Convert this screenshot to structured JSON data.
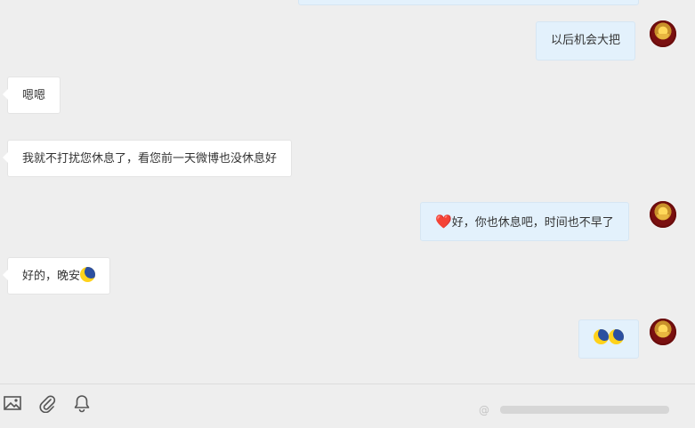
{
  "messages": [
    {
      "side": "out",
      "text": "以后机会大把"
    },
    {
      "side": "in",
      "text": "嗯嗯"
    },
    {
      "side": "in",
      "text": "我就不打扰您休息了，看您前一天微博也没休息好"
    },
    {
      "side": "out",
      "emoji_before": "❤️",
      "text": "好，你也休息吧，时间也不早了"
    },
    {
      "side": "in",
      "text": "好的，晚安",
      "emoji_after": "moon-face"
    },
    {
      "side": "out",
      "emoji": "moon-face x2"
    }
  ],
  "toolbar": {
    "items": [
      "image-icon",
      "attachment-icon",
      "bell-icon"
    ]
  },
  "watermark": {
    "text": "@"
  }
}
